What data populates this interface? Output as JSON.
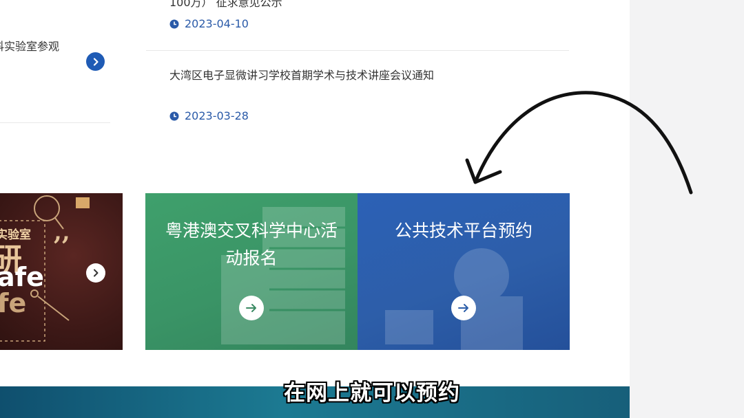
{
  "news": [
    {
      "title": "100万） 征求意见公示",
      "date": "2023-04-10"
    },
    {
      "title": "大湾区电子显微讲习学校首期学术与技术讲座会议通知",
      "date": "2023-03-28"
    }
  ],
  "left_news": {
    "title": "科实验室参观"
  },
  "tiles": {
    "lab_safety": {
      "line1": "实验室",
      "big1": "研",
      "big2": "afe",
      "big3": "fe"
    },
    "activity_signup": {
      "title_line1": "粤港澳交叉科学中心活",
      "title_line2": "动报名"
    },
    "platform_booking": {
      "title": "公共技术平台预约"
    }
  },
  "subtitle": "在网上就可以预约",
  "colors": {
    "accent_blue": "#2a5aa8",
    "tile_green": "#3c9a68",
    "tile_blue": "#2e5fb0",
    "tile_brown": "#4a1f1c"
  }
}
